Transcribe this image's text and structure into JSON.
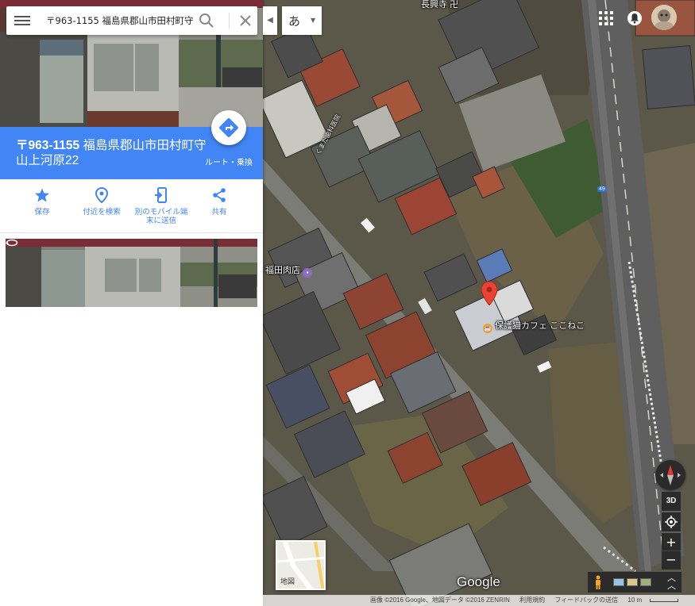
{
  "search": {
    "value": "〒963-1155 福島県郡山市田村町守"
  },
  "place": {
    "postal": "〒963-1155",
    "address_line1": "福島県郡山市田村町守",
    "address_line2": "山上河原22",
    "route_label": "ルート・乗換"
  },
  "actions": [
    {
      "label": "保存",
      "icon": "star-icon"
    },
    {
      "label": "付近を検索",
      "icon": "nearby-pin-icon"
    },
    {
      "label_line1": "別のモバイル端",
      "label_line2": "末に送信",
      "icon": "send-to-device-icon"
    },
    {
      "label": "共有",
      "icon": "share-icon"
    }
  ],
  "ime": {
    "char": "あ"
  },
  "map_labels": {
    "temple": "長興寺",
    "temple_mark": "卍",
    "meat_shop": "福田肉店",
    "cafe": "保護猫カフェ ここねこ",
    "clinic": "くまだ歯科医院",
    "route_shield": "49"
  },
  "map_controls": {
    "three_d": "3D",
    "zoom_in": "+",
    "zoom_out": "−",
    "minimap_label": "地図"
  },
  "branding": {
    "logo": "Google"
  },
  "footer": {
    "imagery": "画像 ©2016 Google、地図データ ©2016 ZENRIN",
    "terms": "利用規約",
    "feedback": "フィードバックの送信",
    "scale": "10 m"
  },
  "colors": {
    "accent": "#4285f4",
    "pin_red": "#ea4335",
    "cafe_orange": "#f29b2a",
    "shop_purple": "#8e6cc2"
  }
}
